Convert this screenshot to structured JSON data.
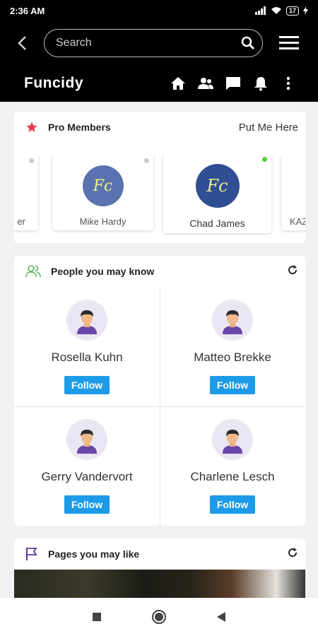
{
  "status": {
    "time": "2:36 AM",
    "battery": "17"
  },
  "search": {
    "placeholder": "Search"
  },
  "brand": {
    "name": "Funcidy"
  },
  "pro": {
    "title": "Pro Members",
    "action": "Put Me Here",
    "members": [
      {
        "name": "er",
        "avatar": "",
        "online": false
      },
      {
        "name": "Mike Hardy",
        "avatar": "Fc",
        "online": false
      },
      {
        "name": "Chad James",
        "avatar": "Fc",
        "online": true
      },
      {
        "name": "KAZ",
        "avatar": "",
        "online": false
      }
    ]
  },
  "people": {
    "title": "People you may know",
    "items": [
      {
        "name": "Rosella Kuhn",
        "button": "Follow"
      },
      {
        "name": "Matteo Brekke",
        "button": "Follow"
      },
      {
        "name": "Gerry Vandervort",
        "button": "Follow"
      },
      {
        "name": "Charlene Lesch",
        "button": "Follow"
      }
    ]
  },
  "pages": {
    "title": "Pages you may like"
  },
  "colors": {
    "accent": "#1d9be8",
    "star": "#e53950",
    "people_icon": "#5cb85c",
    "flag_icon": "#5b3a9a"
  }
}
